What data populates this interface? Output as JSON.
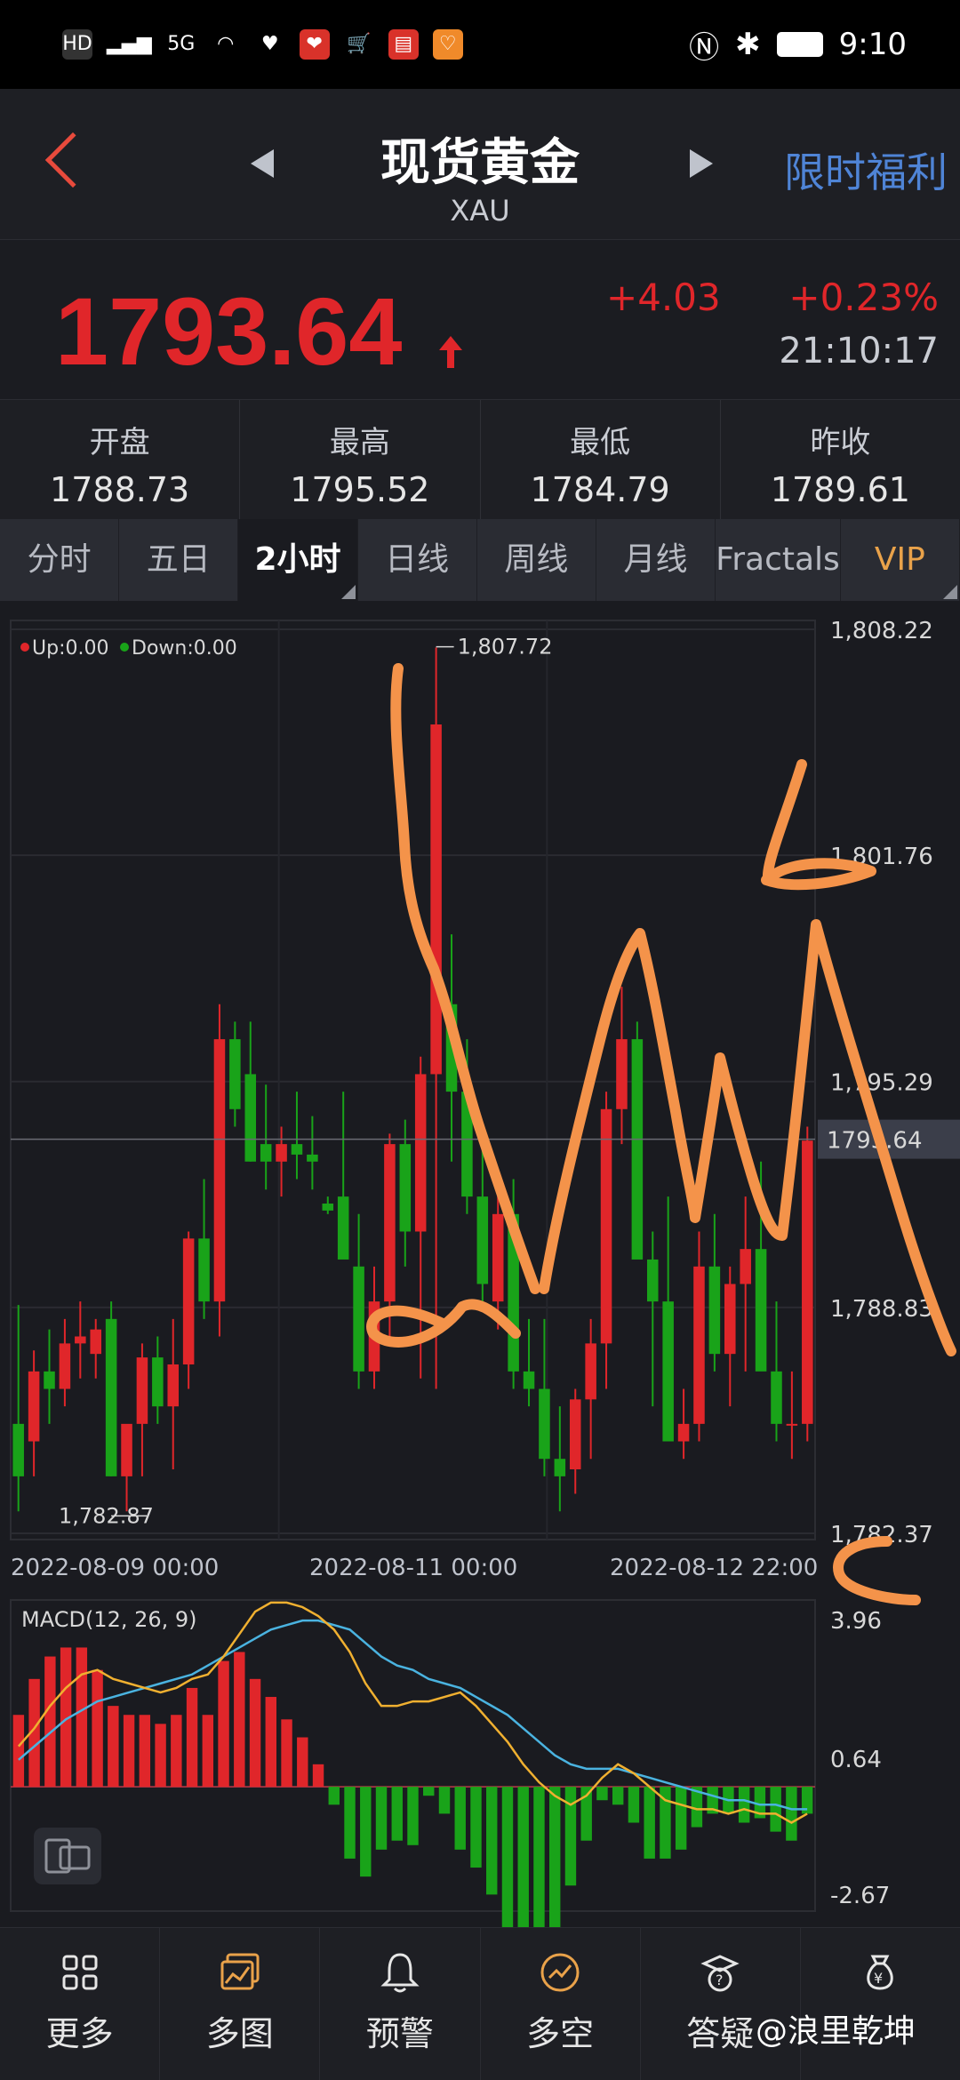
{
  "status": {
    "left_icons": [
      "HD",
      "2",
      "5G",
      "wifi-icon",
      "heart-icon",
      "app-icon",
      "cart-icon",
      "book-icon",
      "app2-icon"
    ],
    "time": "9:10"
  },
  "header": {
    "title": "现货黄金",
    "symbol": "XAU",
    "promo": "限时福利"
  },
  "quote": {
    "price": "1793.64",
    "change": "+4.03",
    "change_pct": "+0.23%",
    "time": "21:10:17"
  },
  "stats": [
    {
      "label": "开盘",
      "value": "1788.73"
    },
    {
      "label": "最高",
      "value": "1795.52"
    },
    {
      "label": "最低",
      "value": "1784.79"
    },
    {
      "label": "昨收",
      "value": "1789.61"
    }
  ],
  "tabs": [
    "分时",
    "五日",
    "2小时",
    "日线",
    "周线",
    "月线",
    "Fractals",
    "VIP"
  ],
  "active_tab": "2小时",
  "chart": {
    "legend_up": "Up:0.00",
    "legend_down": "Down:0.00",
    "high_label": "1,807.72",
    "low_label": "1,782.87",
    "y_ticks": [
      "1,808.22",
      "1,801.76",
      "1,795.29",
      "1,788.83",
      "1,782.37"
    ],
    "current_price_tag": "1793.64",
    "x_labels": [
      "2022-08-09 00:00",
      "2022-08-11 00:00",
      "2022-08-12 22:00"
    ],
    "macd_label": "MACD(12, 26, 9)",
    "macd_ticks": [
      "3.96",
      "0.64",
      "-2.67"
    ],
    "colors": {
      "up": "#e0262a",
      "down": "#19a319",
      "dif": "#f0b030",
      "dea": "#4ab3e0",
      "annotation": "#f4934a"
    }
  },
  "chart_data": {
    "type": "candlestick",
    "ylim": [
      1782.37,
      1808.22
    ],
    "candles": [
      [
        1785.5,
        1788.9,
        1783.0,
        1784.0
      ],
      [
        1785.0,
        1787.6,
        1784.0,
        1787.0
      ],
      [
        1787.0,
        1788.2,
        1785.5,
        1786.5
      ],
      [
        1786.5,
        1788.5,
        1786.0,
        1787.8
      ],
      [
        1787.8,
        1789.0,
        1786.8,
        1788.0
      ],
      [
        1787.5,
        1788.5,
        1786.8,
        1788.2
      ],
      [
        1788.5,
        1789.0,
        1784.0,
        1784.0
      ],
      [
        1784.0,
        1785.0,
        1783.0,
        1785.5
      ],
      [
        1785.5,
        1787.8,
        1784.0,
        1787.4
      ],
      [
        1787.4,
        1788.0,
        1785.5,
        1786.0
      ],
      [
        1786.0,
        1788.5,
        1784.2,
        1787.2
      ],
      [
        1787.2,
        1791.0,
        1786.5,
        1790.8
      ],
      [
        1790.8,
        1792.5,
        1788.5,
        1789.0
      ],
      [
        1789.0,
        1797.5,
        1788.0,
        1796.5
      ],
      [
        1796.5,
        1797.0,
        1794.0,
        1794.5
      ],
      [
        1795.5,
        1797.0,
        1793.0,
        1793.0
      ],
      [
        1793.5,
        1795.2,
        1792.2,
        1793.0
      ],
      [
        1793.0,
        1794.0,
        1792.0,
        1793.5
      ],
      [
        1793.5,
        1795.0,
        1792.5,
        1793.2
      ],
      [
        1793.2,
        1794.3,
        1792.2,
        1793.0
      ],
      [
        1791.8,
        1792.0,
        1791.5,
        1791.6
      ],
      [
        1792.0,
        1795.0,
        1790.5,
        1790.2
      ],
      [
        1790.0,
        1791.5,
        1786.5,
        1787.0
      ],
      [
        1787.0,
        1790.0,
        1786.5,
        1789.0
      ],
      [
        1789.0,
        1793.8,
        1787.8,
        1793.5
      ],
      [
        1793.5,
        1794.2,
        1790.0,
        1791.0
      ],
      [
        1791.0,
        1796.0,
        1786.8,
        1795.5
      ],
      [
        1795.5,
        1807.7,
        1786.5,
        1805.5
      ],
      [
        1797.5,
        1799.5,
        1793.0,
        1795.0
      ],
      [
        1795.0,
        1796.5,
        1791.5,
        1792.0
      ],
      [
        1792.0,
        1793.5,
        1789.0,
        1789.5
      ],
      [
        1789.0,
        1792.5,
        1788.2,
        1791.5
      ],
      [
        1791.5,
        1792.5,
        1786.5,
        1787.0
      ],
      [
        1787.0,
        1788.5,
        1786.0,
        1786.5
      ],
      [
        1786.5,
        1788.5,
        1784.0,
        1784.5
      ],
      [
        1784.5,
        1786.0,
        1783.0,
        1784.0
      ],
      [
        1784.2,
        1786.5,
        1783.5,
        1786.2
      ],
      [
        1786.2,
        1788.5,
        1784.5,
        1787.8
      ],
      [
        1787.8,
        1795.0,
        1786.5,
        1794.5
      ],
      [
        1794.5,
        1798.0,
        1793.5,
        1796.5
      ],
      [
        1796.5,
        1797.0,
        1791.5,
        1790.2
      ],
      [
        1790.2,
        1791.0,
        1786.0,
        1789.0
      ],
      [
        1789.0,
        1792.0,
        1787.0,
        1785.0
      ],
      [
        1785.0,
        1786.5,
        1784.5,
        1785.5
      ],
      [
        1785.5,
        1791.0,
        1785.0,
        1790.0
      ],
      [
        1790.0,
        1791.5,
        1787.0,
        1787.5
      ],
      [
        1787.5,
        1790.0,
        1786.0,
        1789.5
      ],
      [
        1789.5,
        1792.0,
        1787.0,
        1790.5
      ],
      [
        1790.5,
        1793.0,
        1787.5,
        1787.0
      ],
      [
        1787.0,
        1789.0,
        1785.0,
        1785.5
      ],
      [
        1785.5,
        1787.0,
        1784.5,
        1785.5
      ],
      [
        1785.5,
        1794.0,
        1785.0,
        1793.6
      ]
    ],
    "macd_hist": [
      1.6,
      2.4,
      2.9,
      3.1,
      3.1,
      2.6,
      1.8,
      1.6,
      1.6,
      1.4,
      1.6,
      2.2,
      1.6,
      2.8,
      3.0,
      2.4,
      2.0,
      1.5,
      1.1,
      0.5,
      -0.4,
      -1.6,
      -2.0,
      -1.4,
      -1.2,
      -1.3,
      -0.2,
      -0.6,
      -1.4,
      -1.8,
      -2.4,
      -3.5,
      -4.0,
      -4.1,
      -3.6,
      -2.2,
      -1.2,
      -0.3,
      -0.4,
      -0.8,
      -1.6,
      -1.6,
      -1.4,
      -0.9,
      -0.6,
      -0.6,
      -0.8,
      -0.7,
      -1.0,
      -1.2,
      -0.6
    ],
    "macd_dif": [
      0.9,
      1.3,
      1.8,
      2.2,
      2.5,
      2.6,
      2.4,
      2.3,
      2.2,
      2.1,
      2.2,
      2.4,
      2.5,
      2.9,
      3.4,
      3.9,
      4.1,
      4.1,
      4.0,
      3.8,
      3.5,
      3.0,
      2.3,
      1.8,
      1.8,
      1.9,
      1.9,
      2.0,
      2.1,
      1.8,
      1.4,
      1.0,
      0.5,
      0.1,
      -0.2,
      -0.4,
      -0.2,
      0.2,
      0.5,
      0.3,
      0.0,
      -0.3,
      -0.4,
      -0.5,
      -0.5,
      -0.6,
      -0.5,
      -0.6,
      -0.6,
      -0.8,
      -0.6
    ],
    "macd_dea": [
      0.6,
      0.9,
      1.2,
      1.5,
      1.7,
      1.9,
      2.0,
      2.1,
      2.2,
      2.3,
      2.4,
      2.5,
      2.7,
      2.9,
      3.1,
      3.3,
      3.5,
      3.6,
      3.7,
      3.7,
      3.6,
      3.5,
      3.2,
      2.9,
      2.7,
      2.6,
      2.4,
      2.3,
      2.2,
      2.0,
      1.8,
      1.6,
      1.3,
      1.0,
      0.7,
      0.5,
      0.4,
      0.4,
      0.4,
      0.3,
      0.2,
      0.1,
      0.0,
      -0.1,
      -0.2,
      -0.3,
      -0.3,
      -0.4,
      -0.4,
      -0.5,
      -0.5
    ],
    "macd_ylim": [
      -2.67,
      3.96
    ]
  },
  "bottom_nav": [
    {
      "label": "更多",
      "icon": "grid-icon"
    },
    {
      "label": "多图",
      "icon": "multi-chart-icon"
    },
    {
      "label": "预警",
      "icon": "bell-icon"
    },
    {
      "label": "多空",
      "icon": "trend-icon"
    },
    {
      "label": "答疑",
      "icon": "qa-icon"
    },
    {
      "label": "",
      "icon": "money-bag-icon"
    }
  ],
  "watermark": "@浪里乾坤"
}
